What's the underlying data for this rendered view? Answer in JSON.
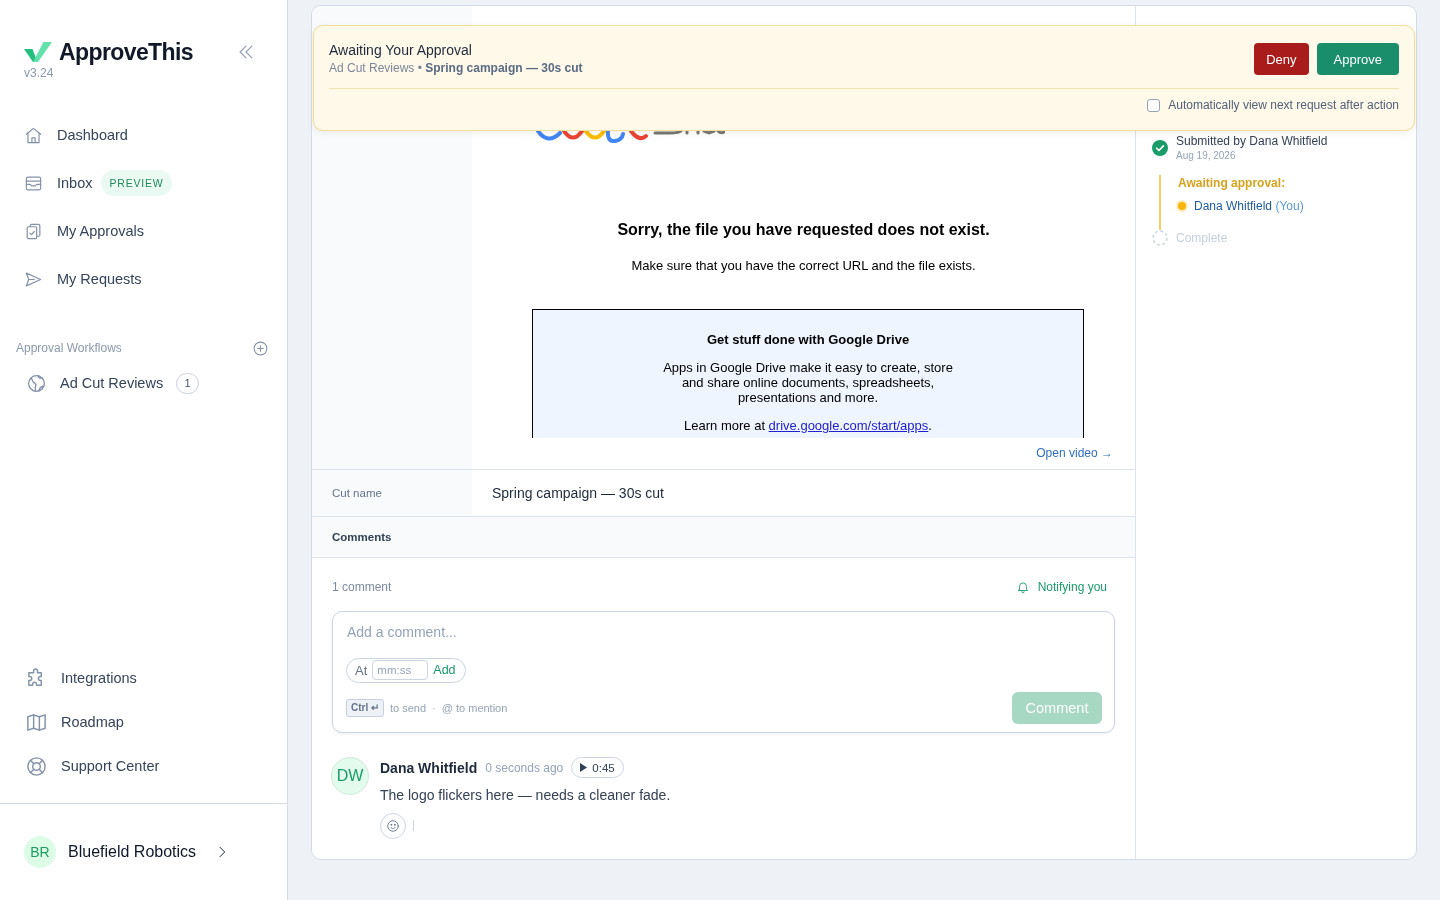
{
  "sidebar": {
    "brand": {
      "name": "ApproveThis",
      "version": "v3.24"
    },
    "nav": [
      {
        "label": "Dashboard",
        "selected": false
      },
      {
        "label": "Inbox",
        "badge": "PREVIEW",
        "selected": false
      },
      {
        "label": "My Approvals",
        "selected": false
      },
      {
        "label": "My Requests",
        "selected": false
      }
    ],
    "workflows": {
      "heading": "Approval Workflows",
      "items": [
        {
          "label": "Ad Cut Reviews",
          "count": "1",
          "selected": false
        }
      ]
    },
    "footer_nav": [
      {
        "label": "Integrations"
      },
      {
        "label": "Roadmap"
      },
      {
        "label": "Support Center"
      }
    ],
    "workspace": {
      "initials": "BR",
      "name": "Bluefield Robotics"
    }
  },
  "approval_banner": {
    "title": "Awaiting Your Approval",
    "subtitle": "Ad Cut Reviews • **Spring campaign — 30s cut**",
    "buttons": [
      {
        "label": "Deny",
        "kind": "deny"
      },
      {
        "label": "Approve",
        "kind": "approve"
      }
    ],
    "auto_next": {
      "label": "Automatically view next request after action",
      "checked": false
    }
  },
  "request": {
    "video": {
      "embed": {
        "heading": "Sorry, the file you have requested does not exist.",
        "message": "Make sure that you have the correct URL and the file exists.",
        "promo": {
          "title": "Get stuff done with Google Drive",
          "body": "Apps in Google Drive make it easy to create, store and share online documents, spreadsheets, presentations and more.",
          "learn_more": "Learn more at ",
          "link": "drive.google.com/start/apps",
          "end": "."
        }
      },
      "open_link": "Open video →"
    },
    "fields": [
      {
        "label": "Cut name",
        "value": "Spring campaign — 30s cut"
      }
    ],
    "comments": {
      "heading": "Comments",
      "count": "1 comment",
      "notify": "Notifying you",
      "composer": {
        "placeholder": "Add a comment...",
        "time_prefix": "At",
        "time_placeholder": "mm:ss",
        "time_add": "Add",
        "hint_key": "Ctrl ↵",
        "hint_send": "to send",
        "hint_sep": "·",
        "hint_mention": "@ to mention",
        "submit": {
          "label": "Comment",
          "disabled": true
        }
      },
      "items": [
        {
          "initials": "DW",
          "author": "Dana Whitfield",
          "time": "0 seconds ago",
          "timestamp": "0:45",
          "text": "The logo flickers here — needs a cleaner fade."
        }
      ]
    }
  },
  "timeline": [
    {
      "kind": "done",
      "title": "Submitted by Dana Whitfield",
      "date": "Aug 19, 2026"
    },
    {
      "kind": "pending",
      "title": "Awaiting approval:",
      "approvers": [
        {
          "name": "Dana Whitfield",
          "note": "(You)"
        }
      ]
    },
    {
      "kind": "future",
      "title": "Complete"
    }
  ]
}
